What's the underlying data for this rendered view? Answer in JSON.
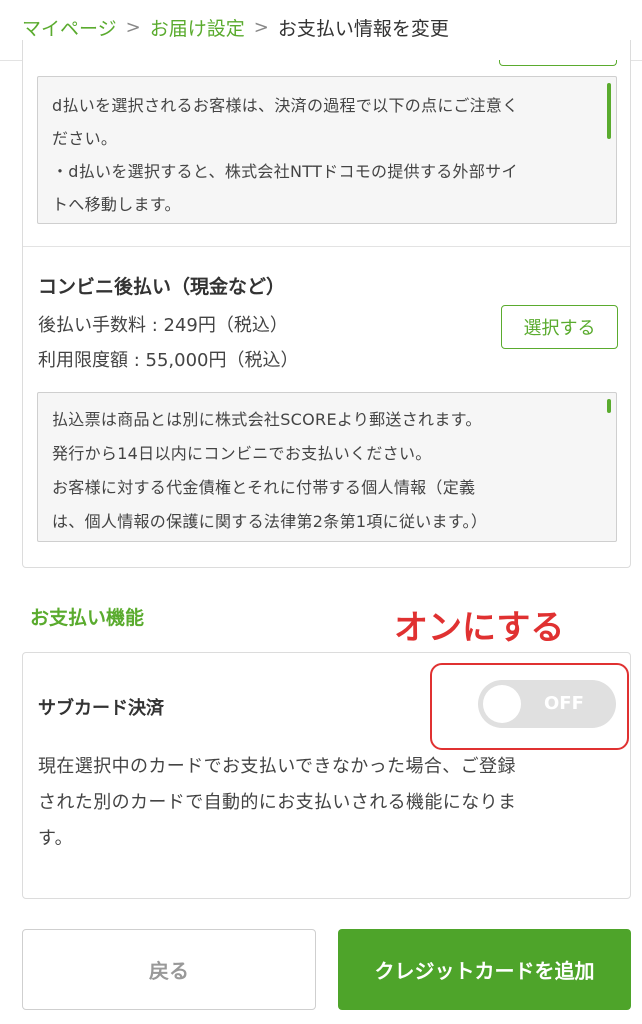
{
  "breadcrumb": {
    "items": [
      {
        "label": "マイページ"
      },
      {
        "label": "お届け設定"
      }
    ],
    "separator": ">",
    "current": "お支払い情報を変更"
  },
  "d_payment": {
    "notice_lines": [
      "d払いを選択されるお客様は、決済の過程で以下の点にご注意く",
      "ださい。",
      "・d払いを選択すると、株式会社NTTドコモの提供する外部サイ",
      "トへ移動します。"
    ]
  },
  "convenience": {
    "title": "コンビニ後払い（現金など）",
    "fee": "後払い手数料 : 249円（税込）",
    "limit": "利用限度額 : 55,000円（税込）",
    "select_label": "選択する",
    "notice_lines": [
      "払込票は商品とは別に株式会社SCOREより郵送されます。",
      "発行から14日以内にコンビニでお支払いください。",
      "お客様に対する代金債権とそれに付帯する個人情報（定義",
      "は、個人情報の保護に関する法律第2条第1項に従います。）"
    ]
  },
  "payment_features": {
    "heading": "お支払い機能",
    "callout": "オンにする",
    "sub_card": {
      "title": "サブカード決済",
      "toggle_state": "OFF",
      "description_lines": [
        "現在選択中のカードでお支払いできなかった場合、ご登録",
        "された別のカードで自動的にお支払いされる機能になりま",
        "す。"
      ]
    }
  },
  "footer": {
    "back_label": "戻る",
    "add_card_label": "クレジットカードを追加"
  },
  "colors": {
    "accent_green": "#5aab2e",
    "callout_red": "#e03131",
    "toggle_off": "#e0e0e0"
  }
}
